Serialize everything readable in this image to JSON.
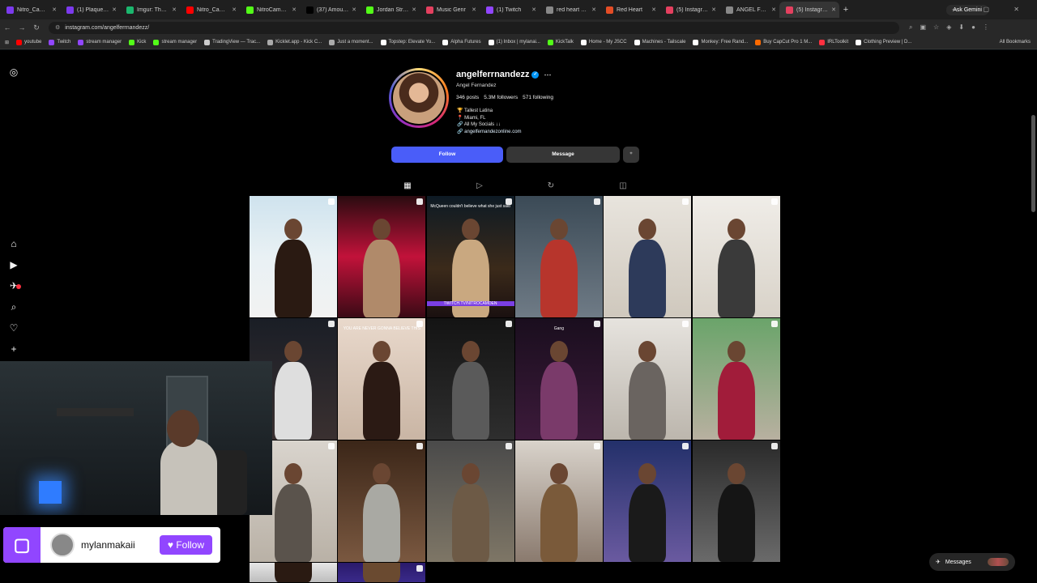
{
  "browser": {
    "tabs": [
      {
        "label": "Nitro_Camden's",
        "color": "#7c3aed"
      },
      {
        "label": "(1) PlaqueBoyM",
        "color": "#7c3aed"
      },
      {
        "label": "Imgur: The mag",
        "color": "#1bb76e"
      },
      {
        "label": "Nitro_Camden",
        "color": "#ff0000"
      },
      {
        "label": "NitroCamden V",
        "color": "#53fc18"
      },
      {
        "label": "(37) Amouxnro",
        "color": "#000000"
      },
      {
        "label": "Jordan Stream",
        "color": "#53fc18"
      },
      {
        "label": "Music Genr",
        "color": "#e4405f"
      },
      {
        "label": "(1) Twitch",
        "color": "#9146ff"
      },
      {
        "label": "red heart copy",
        "color": "#888888"
      },
      {
        "label": "Red Heart",
        "color": "#e44d26"
      },
      {
        "label": "(5) Instagram",
        "color": "#e4405f"
      },
      {
        "label": "ANGEL FERNAN",
        "color": "#888888"
      },
      {
        "label": "(5) Instagram",
        "color": "#e4405f",
        "active": true
      }
    ],
    "new_tab": "+",
    "gemini": "Ask Gemini",
    "url": "instagram.com/angelferrnandezz/",
    "bookmarks": [
      {
        "label": "youtube",
        "color": "#ff0000"
      },
      {
        "label": "Twitch",
        "color": "#9146ff"
      },
      {
        "label": "stream manager",
        "color": "#9146ff"
      },
      {
        "label": "Kick",
        "color": "#53fc18"
      },
      {
        "label": "stream manager",
        "color": "#53fc18"
      },
      {
        "label": "TradingView — Trac...",
        "color": "#cccccc"
      },
      {
        "label": "Kicklet.app - Kick C...",
        "color": "#aaaaaa"
      },
      {
        "label": "Just a moment...",
        "color": "#aaaaaa"
      },
      {
        "label": "Topstep: Elevate Yo...",
        "color": "#ffffff"
      },
      {
        "label": "Alpha Futures",
        "color": "#ffffff"
      },
      {
        "label": "(1) Inbox | mylanai...",
        "color": "#ffffff"
      },
      {
        "label": "KickTalk",
        "color": "#53fc18"
      },
      {
        "label": "Home - My JSCC",
        "color": "#ffffff"
      },
      {
        "label": "Machines - Tailscale",
        "color": "#ffffff"
      },
      {
        "label": "Monkey: Free Rand...",
        "color": "#ffffff"
      },
      {
        "label": "Buy CapCut Pro 1 M...",
        "color": "#ff6a00"
      },
      {
        "label": "IRLToolkit",
        "color": "#ff3040"
      },
      {
        "label": "Clothing Preview | D...",
        "color": "#ffffff"
      }
    ],
    "all_bookmarks": "All Bookmarks"
  },
  "profile": {
    "username": "angelferrnandezz",
    "full_name": "Angel Fernandez",
    "posts": "346 posts",
    "followers": "5.3M followers",
    "following": "571 following",
    "bio": [
      "Tallest Latina",
      "Miami, FL",
      "All My Socials ↓↓",
      "angelfernandezonline.com"
    ],
    "follow_label": "Follow",
    "message_label": "Message",
    "suggest_icon": "add-person-icon"
  },
  "posts": [
    {
      "bg": "linear-gradient(180deg,#cfe3ee 0%,#e9f1f4 50%,#f2f2f2 100%)",
      "fig": "#2a1a12",
      "pin": "pin"
    },
    {
      "bg": "linear-gradient(180deg,#2a0b10 0%,#c2123a 50%,#3a0a15 100%)",
      "fig": "#b08a6a",
      "pin": "pin"
    },
    {
      "bg": "linear-gradient(180deg,#0d1a24 0%,#3b2a1a 60%,#1a1010 100%)",
      "fig": "#c9a880",
      "pin": "reel",
      "caption": "McQueen couldn't believe what she just said",
      "footer": "TWITCH.TV/NITROCAMDEN"
    },
    {
      "bg": "linear-gradient(180deg,#3b4a56 0%,#6f7b86 100%)",
      "fig": "#b7352c",
      "pin": "reel"
    },
    {
      "bg": "linear-gradient(180deg,#e8e4dd 0%,#cfc8bd 100%)",
      "fig": "#2d3a5a",
      "pin": "reel"
    },
    {
      "bg": "linear-gradient(180deg,#f0ede8 0%,#d8d2c8 100%)",
      "fig": "#3a3a3a",
      "pin": "reel"
    },
    {
      "bg": "linear-gradient(180deg,#1a1e26 0%,#3a3030 100%)",
      "fig": "#dedede",
      "pin": "reel"
    },
    {
      "bg": "linear-gradient(180deg,#e9d9cc 0%,#c9b5a4 100%)",
      "fig": "#2b1a14",
      "pin": "reel",
      "caption": "YOU ARE NEVER GONNA BELIEVE THIS"
    },
    {
      "bg": "linear-gradient(180deg,#141414 0%,#2e2e2e 100%)",
      "fig": "#5a5a5a",
      "pin": "reel"
    },
    {
      "bg": "linear-gradient(180deg,#1a0e1e 0%,#3c1a3a 100%)",
      "fig": "#7a3a6a",
      "pin": "reel",
      "caption": "Gang"
    },
    {
      "bg": "linear-gradient(180deg,#e6e3de 0%,#bcb6ad 100%)",
      "fig": "#6a6460",
      "pin": "reel"
    },
    {
      "bg": "linear-gradient(180deg,#6aa46a 0%,#b8b0a0 100%)",
      "fig": "#a11c3a",
      "pin": "reel"
    },
    {
      "bg": "linear-gradient(180deg,#d9d4cd 0%,#b9b1a6 100%)",
      "fig": "#5a534c",
      "pin": "reel"
    },
    {
      "bg": "linear-gradient(180deg,#3b2618 0%,#7a5840 100%)",
      "fig": "#a9a9a3",
      "pin": "reel"
    },
    {
      "bg": "linear-gradient(180deg,#4a4a4a 0%,#7e7666 100%)",
      "fig": "#6d5a46",
      "pin": "reel"
    },
    {
      "bg": "linear-gradient(180deg,#d9d3cb 0%,#8a7a6e 100%)",
      "fig": "#7a5a3a",
      "pin": "reel"
    },
    {
      "bg": "linear-gradient(180deg,#23306a 0%,#6a5aa0 100%)",
      "fig": "#1a1a1a",
      "pin": "reel"
    },
    {
      "bg": "linear-gradient(180deg,#2a2a2a 0%,#6a6a6a 100%)",
      "fig": "#151515",
      "pin": "reel"
    },
    {
      "bg": "linear-gradient(180deg,#e6e6e6 0%,#bdbdbd 100%)",
      "fig": "#2a1a12",
      "pin": "none"
    },
    {
      "bg": "linear-gradient(180deg,#2a1a6a 0%,#3a2a8a 100%)",
      "fig": "#6a4a30",
      "pin": "reel"
    }
  ],
  "twitch_overlay": {
    "username": "mylanmakaii",
    "follow": "Follow"
  },
  "messages_label": "Messages"
}
